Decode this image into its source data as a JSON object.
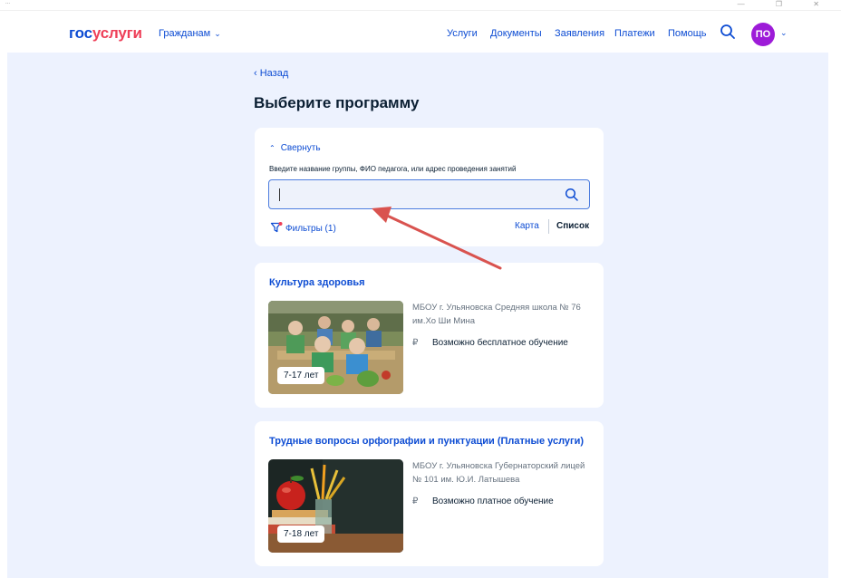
{
  "window": {
    "top_strip_text": "...",
    "controls": "—   ❐   ✕"
  },
  "header": {
    "logo_part1": "гос",
    "logo_part2": "услуги",
    "citizens_label": "Гражданам",
    "nav": [
      "Услуги",
      "Документы",
      "Заявления",
      "Платежи",
      "Помощь"
    ],
    "avatar_initials": "ПО"
  },
  "page": {
    "back_label": "Назад",
    "title": "Выберите программу"
  },
  "filter": {
    "collapse_label": "Свернуть",
    "search_label": "Введите название группы, ФИО педагога, или адрес проведения занятий",
    "search_value": "",
    "filters_label": "Фильтры (1)",
    "map_label": "Карта",
    "list_label": "Список"
  },
  "programs": [
    {
      "title": "Культура здоровья",
      "age": "7-17 лет",
      "org": "МБОУ г. Ульяновска Средняя школа № 76 им.Хо Ши Мина",
      "price": "Возможно бесплатное обучение"
    },
    {
      "title": "Трудные вопросы орфографии и пунктуации (Платные услуги)",
      "age": "7-18 лет",
      "org": "МБОУ г. Ульяновска Губернаторский лицей № 101 им. Ю.И. Латышева",
      "price": "Возможно платное обучение"
    }
  ],
  "colors": {
    "brand_blue": "#0d4cd3",
    "brand_red": "#ee3f58",
    "avatar": "#9d1bd8",
    "page_bg": "#edf2fe",
    "annotation_arrow": "#d9534f"
  },
  "icons": [
    "search-icon",
    "chevron-down-icon",
    "chevron-up-icon",
    "chevron-left-icon",
    "filter-icon",
    "ruble-crossed-icon",
    "ruble-icon",
    "annotation-arrow"
  ]
}
